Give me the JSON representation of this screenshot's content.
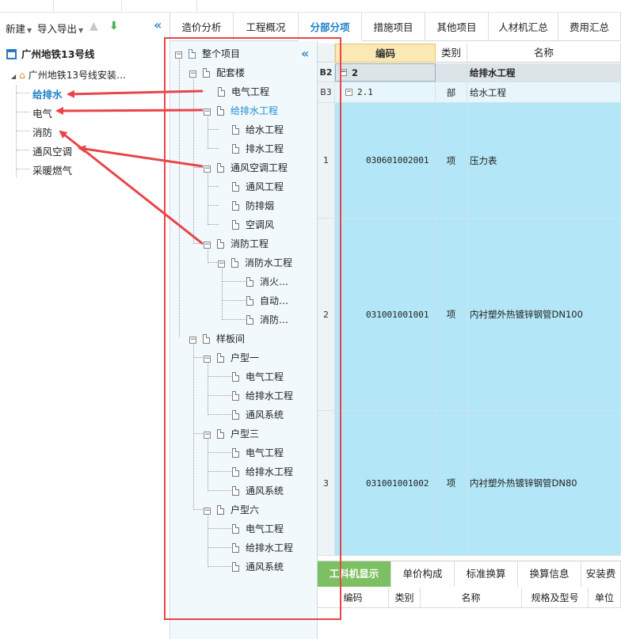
{
  "toolbar": {
    "new": "新建",
    "import_export": "导入导出"
  },
  "project_tree": {
    "root": "广州地铁13号线",
    "sub": "广州地铁13号线安装…",
    "items": [
      "给排水",
      "电气",
      "消防",
      "通风空调",
      "采暖燃气"
    ]
  },
  "tabs": [
    "造价分析",
    "工程概况",
    "分部分项",
    "措施项目",
    "其他项目",
    "人材机汇总",
    "费用汇总"
  ],
  "tree": {
    "root": "整个项目",
    "n1": "配套楼",
    "n1_1": "电气工程",
    "n1_2": "给排水工程",
    "n1_2_1": "给水工程",
    "n1_2_2": "排水工程",
    "n1_3": "通风空调工程",
    "n1_3_1": "通风工程",
    "n1_3_2": "防排烟",
    "n1_3_3": "空调风",
    "n1_4": "消防工程",
    "n1_4_1": "消防水工程",
    "n1_4_1_1": "消火…",
    "n1_4_1_2": "自动…",
    "n1_4_1_3": "消防…",
    "n2": "样板间",
    "n2_1": "户型一",
    "n2_1_1": "电气工程",
    "n2_1_2": "给排水工程",
    "n2_1_3": "通风系统",
    "n2_2": "户型三",
    "n2_2_1": "电气工程",
    "n2_2_2": "给排水工程",
    "n2_2_3": "通风系统",
    "n2_3": "户型六",
    "n2_3_1": "电气工程",
    "n2_3_2": "给排水工程",
    "n2_3_3": "通风系统"
  },
  "grid": {
    "headers": {
      "code": "编码",
      "type": "类别",
      "name": "名称"
    },
    "rows": [
      {
        "num": "B2",
        "code": "2",
        "type": "",
        "name": "给排水工程"
      },
      {
        "num": "B3",
        "code": "2.1",
        "type": "部",
        "name": "给水工程"
      },
      {
        "num": "1",
        "code": "030601002001",
        "type": "项",
        "name": "压力表"
      },
      {
        "num": "2",
        "code": "031001001001",
        "type": "项",
        "name": "内衬塑外热镀锌钢管DN100"
      },
      {
        "num": "3",
        "code": "031001001002",
        "type": "项",
        "name": "内衬塑外热镀锌钢管DN80"
      }
    ]
  },
  "bottom": {
    "tabs": [
      "工料机显示",
      "单价构成",
      "标准换算",
      "换算信息",
      "安装费"
    ],
    "headers": [
      "编码",
      "类别",
      "名称",
      "规格及型号",
      "单位"
    ]
  },
  "colors": {
    "accent": "#1e7fc6",
    "annotation": "#e8454a",
    "row_highlight": "#b3e6f6",
    "active_tab_green": "#7cc063"
  }
}
